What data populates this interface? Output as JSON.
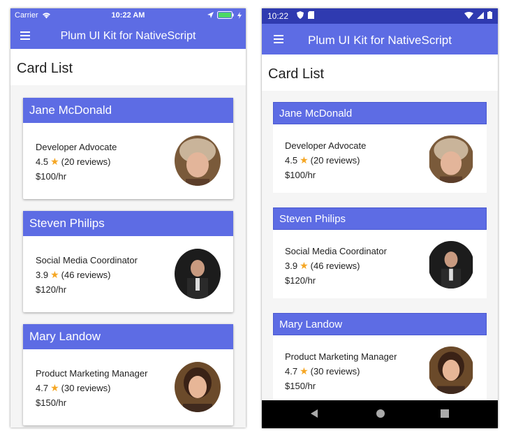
{
  "ios": {
    "status": {
      "carrier": "Carrier",
      "time": "10:22 AM"
    },
    "action_bar": {
      "title": "Plum UI Kit for NativeScript"
    },
    "page_title": "Card List"
  },
  "android": {
    "status": {
      "time": "10:22"
    },
    "action_bar": {
      "title": "Plum UI Kit for NativeScript"
    },
    "page_title": "Card List"
  },
  "cards": [
    {
      "name": "Jane McDonald",
      "role": "Developer Advocate",
      "rating": "4.5",
      "reviews": "(20 reviews)",
      "rate": "$100/hr"
    },
    {
      "name": "Steven Philips",
      "role": "Social Media Coordinator",
      "rating": "3.9",
      "reviews": "(46 reviews)",
      "rate": "$120/hr"
    },
    {
      "name": "Mary Landow",
      "role": "Product Marketing Manager",
      "rating": "4.7",
      "reviews": "(30 reviews)",
      "rate": "$150/hr"
    }
  ],
  "icons": {
    "menu": "hamburger-menu-icon",
    "star": "star-icon",
    "wifi": "wifi-icon",
    "battery": "battery-icon",
    "location": "location-arrow-icon",
    "back": "back-triangle-icon",
    "home": "home-circle-icon",
    "recents": "recents-square-icon"
  },
  "colors": {
    "accent": "#5d6ce4",
    "android_status": "#2f3ab0",
    "star": "#f5a623"
  }
}
